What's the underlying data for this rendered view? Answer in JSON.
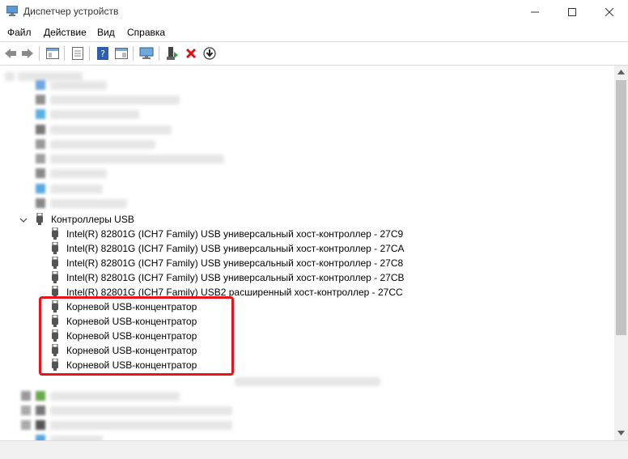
{
  "window": {
    "title": "Диспетчер устройств"
  },
  "menu": {
    "file": "Файл",
    "action": "Действие",
    "view": "Вид",
    "help": "Справка"
  },
  "tree": {
    "category": "Контроллеры USB",
    "devices": [
      "Intel(R) 82801G (ICH7 Family) USB универсальный хост-контроллер  - 27C9",
      "Intel(R) 82801G (ICH7 Family) USB универсальный хост-контроллер  - 27CA",
      "Intel(R) 82801G (ICH7 Family) USB универсальный хост-контроллер  - 27C8",
      "Intel(R) 82801G (ICH7 Family) USB универсальный хост-контроллер  - 27CB",
      "Intel(R) 82801G (ICH7 Family) USB2 расширенный хост-контроллер  - 27CC",
      "Корневой USB-концентратор",
      "Корневой USB-концентратор",
      "Корневой USB-концентратор",
      "Корневой USB-концентратор",
      "Корневой USB-концентратор"
    ]
  },
  "colors": {
    "highlight": "#e8141b"
  }
}
